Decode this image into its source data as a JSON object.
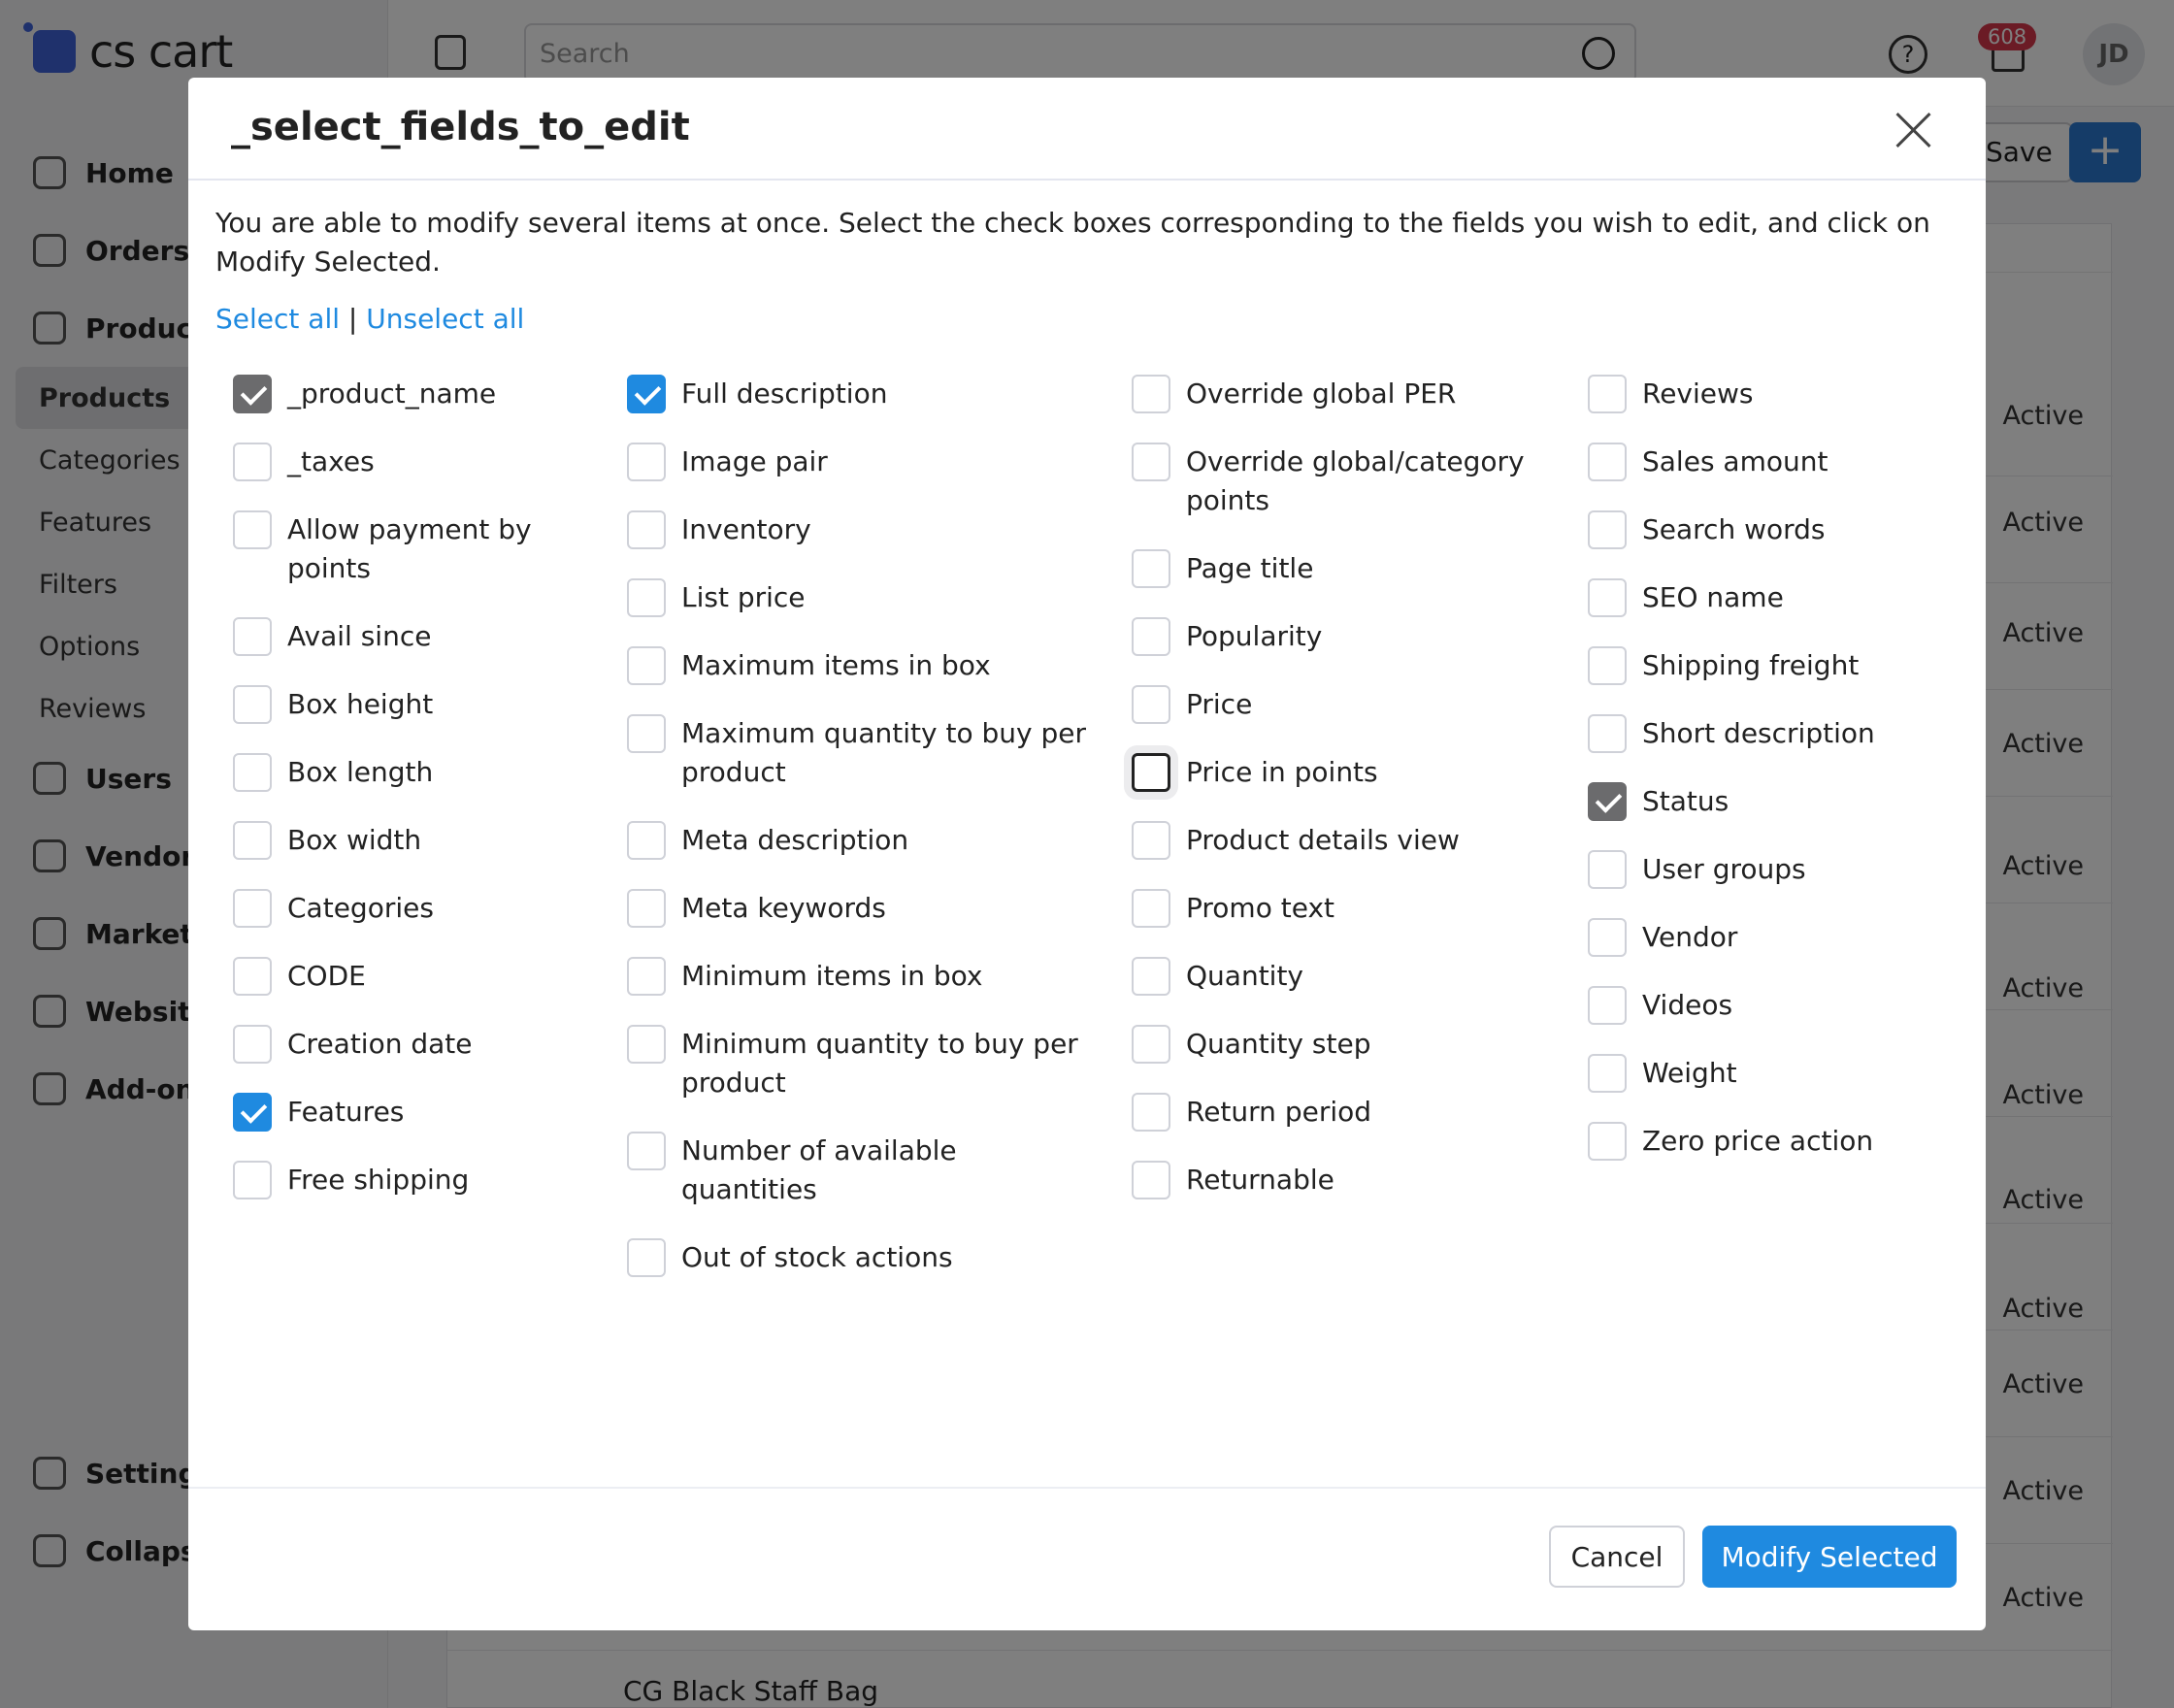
{
  "app": {
    "brand": "cs cart",
    "search_placeholder": "Search",
    "notifications_count": "608",
    "user_initials": "JD",
    "help_glyph": "?",
    "save_label": "Save",
    "add_label": "+"
  },
  "sidebar": {
    "items": [
      {
        "label": "Home",
        "icon": "home-icon"
      },
      {
        "label": "Orders",
        "icon": "inbox-icon"
      },
      {
        "label": "Product",
        "icon": "tag-icon"
      }
    ],
    "sub_items": [
      "Products",
      "Categories",
      "Features",
      "Filters",
      "Options",
      "Reviews"
    ],
    "items_after": [
      {
        "label": "Users",
        "icon": "user-icon"
      },
      {
        "label": "Vendors",
        "icon": "users-icon"
      },
      {
        "label": "Marketi",
        "icon": "megaphone-icon"
      },
      {
        "label": "Website",
        "icon": "monitor-icon"
      },
      {
        "label": "Add-ons",
        "icon": "puzzle-icon"
      }
    ],
    "bottom": [
      {
        "label": "Settings",
        "icon": "gear-icon"
      },
      {
        "label": "Collapse",
        "icon": "chevrons-left-icon"
      }
    ]
  },
  "background_rows": {
    "status_label": "Active",
    "last_product": "CG Black Staff Bag"
  },
  "modal": {
    "title": "_select_fields_to_edit",
    "intro": "You are able to modify several items at once. Select the check boxes corresponding to the fields you wish to edit, and click on Modify Selected.",
    "select_all": "Select all",
    "separator": "|",
    "unselect_all": "Unselect all",
    "columns": [
      [
        {
          "label": "_product_name",
          "checked": true,
          "style": "gray"
        },
        {
          "label": "_taxes",
          "checked": false
        },
        {
          "label": "Allow payment by points",
          "checked": false
        },
        {
          "label": "Avail since",
          "checked": false
        },
        {
          "label": "Box height",
          "checked": false
        },
        {
          "label": "Box length",
          "checked": false
        },
        {
          "label": "Box width",
          "checked": false
        },
        {
          "label": "Categories",
          "checked": false
        },
        {
          "label": "CODE",
          "checked": false
        },
        {
          "label": "Creation date",
          "checked": false
        },
        {
          "label": "Features",
          "checked": true,
          "style": "blue"
        },
        {
          "label": "Free shipping",
          "checked": false
        }
      ],
      [
        {
          "label": "Full description",
          "checked": true,
          "style": "blue"
        },
        {
          "label": "Image pair",
          "checked": false
        },
        {
          "label": "Inventory",
          "checked": false
        },
        {
          "label": "List price",
          "checked": false
        },
        {
          "label": "Maximum items in box",
          "checked": false
        },
        {
          "label": "Maximum quantity to buy per product",
          "checked": false
        },
        {
          "label": "Meta description",
          "checked": false
        },
        {
          "label": "Meta keywords",
          "checked": false
        },
        {
          "label": "Minimum items in box",
          "checked": false
        },
        {
          "label": "Minimum quantity to buy per product",
          "checked": false
        },
        {
          "label": "Number of available quantities",
          "checked": false
        },
        {
          "label": "Out of stock actions",
          "checked": false
        }
      ],
      [
        {
          "label": "Override global PER",
          "checked": false
        },
        {
          "label": "Override global/category points",
          "checked": false
        },
        {
          "label": "Page title",
          "checked": false
        },
        {
          "label": "Popularity",
          "checked": false
        },
        {
          "label": "Price",
          "checked": false
        },
        {
          "label": "Price in points",
          "checked": false,
          "focused": true
        },
        {
          "label": "Product details view",
          "checked": false
        },
        {
          "label": "Promo text",
          "checked": false
        },
        {
          "label": "Quantity",
          "checked": false
        },
        {
          "label": "Quantity step",
          "checked": false
        },
        {
          "label": "Return period",
          "checked": false
        },
        {
          "label": "Returnable",
          "checked": false
        }
      ],
      [
        {
          "label": "Reviews",
          "checked": false
        },
        {
          "label": "Sales amount",
          "checked": false
        },
        {
          "label": "Search words",
          "checked": false
        },
        {
          "label": "SEO name",
          "checked": false
        },
        {
          "label": "Shipping freight",
          "checked": false
        },
        {
          "label": "Short description",
          "checked": false
        },
        {
          "label": "Status",
          "checked": true,
          "style": "gray"
        },
        {
          "label": "User groups",
          "checked": false
        },
        {
          "label": "Vendor",
          "checked": false
        },
        {
          "label": "Videos",
          "checked": false
        },
        {
          "label": "Weight",
          "checked": false
        },
        {
          "label": "Zero price action",
          "checked": false
        }
      ]
    ],
    "cancel_label": "Cancel",
    "modify_label": "Modify Selected"
  },
  "colors": {
    "accent": "#1f8ae0",
    "checked_gray": "#6b6b6d",
    "badge": "#d7364b"
  }
}
